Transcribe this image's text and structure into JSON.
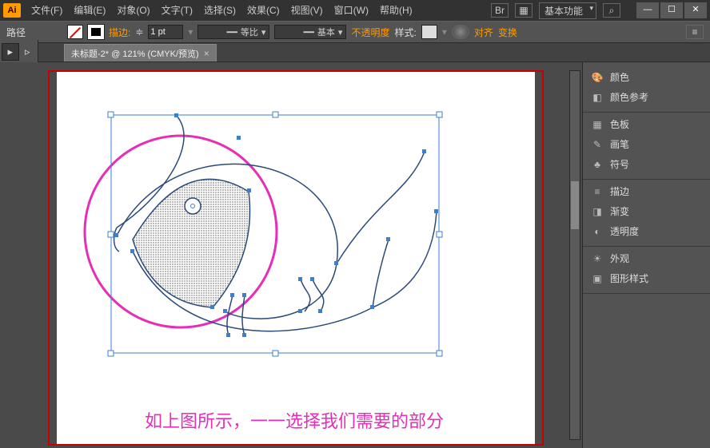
{
  "titlebar": {
    "logo": "Ai",
    "menu": [
      "文件(F)",
      "编辑(E)",
      "对象(O)",
      "文字(T)",
      "选择(S)",
      "效果(C)",
      "视图(V)",
      "窗口(W)",
      "帮助(H)"
    ],
    "workspace": "基本功能"
  },
  "ctrlbar": {
    "sel_label": "路径",
    "stroke_label": "描边:",
    "stroke_value": "1 pt",
    "dd1": "等比",
    "dd2": "基本",
    "opacity_label": "不透明度",
    "style_label": "样式:",
    "align": "对齐",
    "transform": "变换"
  },
  "doc_tab": "未标题-2* @ 121% (CMYK/预览)",
  "canvas": {
    "caption": "如上图所示，一一选择我们需要的部分"
  },
  "panels": {
    "color": "颜色",
    "color_guide": "颜色参考",
    "swatches": "色板",
    "brushes": "画笔",
    "symbols": "符号",
    "stroke": "描边",
    "gradient": "渐变",
    "transparency": "透明度",
    "appearance": "外观",
    "graphic_styles": "图形样式"
  }
}
